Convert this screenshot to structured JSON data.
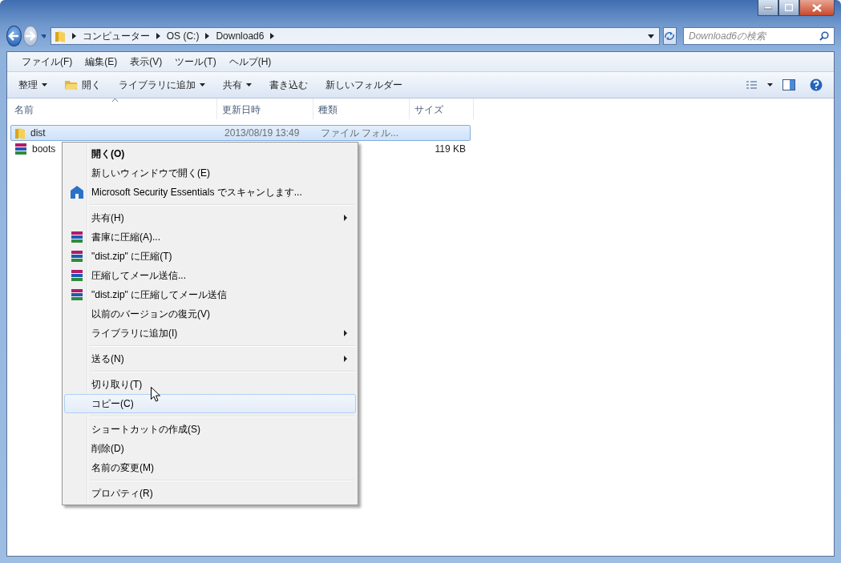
{
  "breadcrumb": [
    "コンピューター",
    "OS (C:)",
    "Download6"
  ],
  "search": {
    "placeholder": "Download6の検索"
  },
  "menu_bar": [
    "ファイル(F)",
    "編集(E)",
    "表示(V)",
    "ツール(T)",
    "ヘルプ(H)"
  ],
  "toolbar": [
    {
      "label": "整理",
      "dropdown": true
    },
    {
      "label": "開く",
      "dropdown": false
    },
    {
      "label": "ライブラリに追加",
      "dropdown": true
    },
    {
      "label": "共有",
      "dropdown": true
    },
    {
      "label": "書き込む",
      "dropdown": false
    },
    {
      "label": "新しいフォルダー",
      "dropdown": false
    }
  ],
  "columns": [
    "名前",
    "更新日時",
    "種類",
    "サイズ"
  ],
  "files": [
    {
      "kind": "folder",
      "name": "dist",
      "date": "2013/08/19 13:49",
      "type": "ファイル フォル...",
      "selected": true
    },
    {
      "kind": "archive",
      "name": "boots",
      "size": "119 KB",
      "selected": false
    }
  ],
  "context_menu": [
    {
      "kind": "plain",
      "label": "開く(O)",
      "bold": true,
      "submenu": false,
      "selected": false
    },
    {
      "kind": "plain",
      "label": "新しいウィンドウで開く(E)",
      "bold": false,
      "submenu": false,
      "selected": false
    },
    {
      "kind": "scan",
      "label": "Microsoft Security Essentials でスキャンします...",
      "bold": false,
      "submenu": false,
      "selected": false
    },
    {
      "kind": "separator"
    },
    {
      "kind": "plain",
      "label": "共有(H)",
      "bold": false,
      "submenu": true,
      "selected": false
    },
    {
      "kind": "archive",
      "label": "書庫に圧縮(A)...",
      "bold": false,
      "submenu": false,
      "selected": false
    },
    {
      "kind": "archive",
      "label": "\"dist.zip\" に圧縮(T)",
      "bold": false,
      "submenu": false,
      "selected": false
    },
    {
      "kind": "archive",
      "label": "圧縮してメール送信...",
      "bold": false,
      "submenu": false,
      "selected": false
    },
    {
      "kind": "archive",
      "label": "\"dist.zip\" に圧縮してメール送信",
      "bold": false,
      "submenu": false,
      "selected": false
    },
    {
      "kind": "plain",
      "label": "以前のバージョンの復元(V)",
      "bold": false,
      "submenu": false,
      "selected": false
    },
    {
      "kind": "plain",
      "label": "ライブラリに追加(I)",
      "bold": false,
      "submenu": true,
      "selected": false
    },
    {
      "kind": "separator"
    },
    {
      "kind": "plain",
      "label": "送る(N)",
      "bold": false,
      "submenu": true,
      "selected": false
    },
    {
      "kind": "separator"
    },
    {
      "kind": "plain",
      "label": "切り取り(T)",
      "bold": false,
      "submenu": false,
      "selected": false
    },
    {
      "kind": "plain",
      "label": "コピー(C)",
      "bold": false,
      "submenu": false,
      "selected": true
    },
    {
      "kind": "separator"
    },
    {
      "kind": "plain",
      "label": "ショートカットの作成(S)",
      "bold": false,
      "submenu": false,
      "selected": false
    },
    {
      "kind": "plain",
      "label": "削除(D)",
      "bold": false,
      "submenu": false,
      "selected": false
    },
    {
      "kind": "plain",
      "label": "名前の変更(M)",
      "bold": false,
      "submenu": false,
      "selected": false
    },
    {
      "kind": "separator"
    },
    {
      "kind": "plain",
      "label": "プロパティ(R)",
      "bold": false,
      "submenu": false,
      "selected": false
    }
  ]
}
